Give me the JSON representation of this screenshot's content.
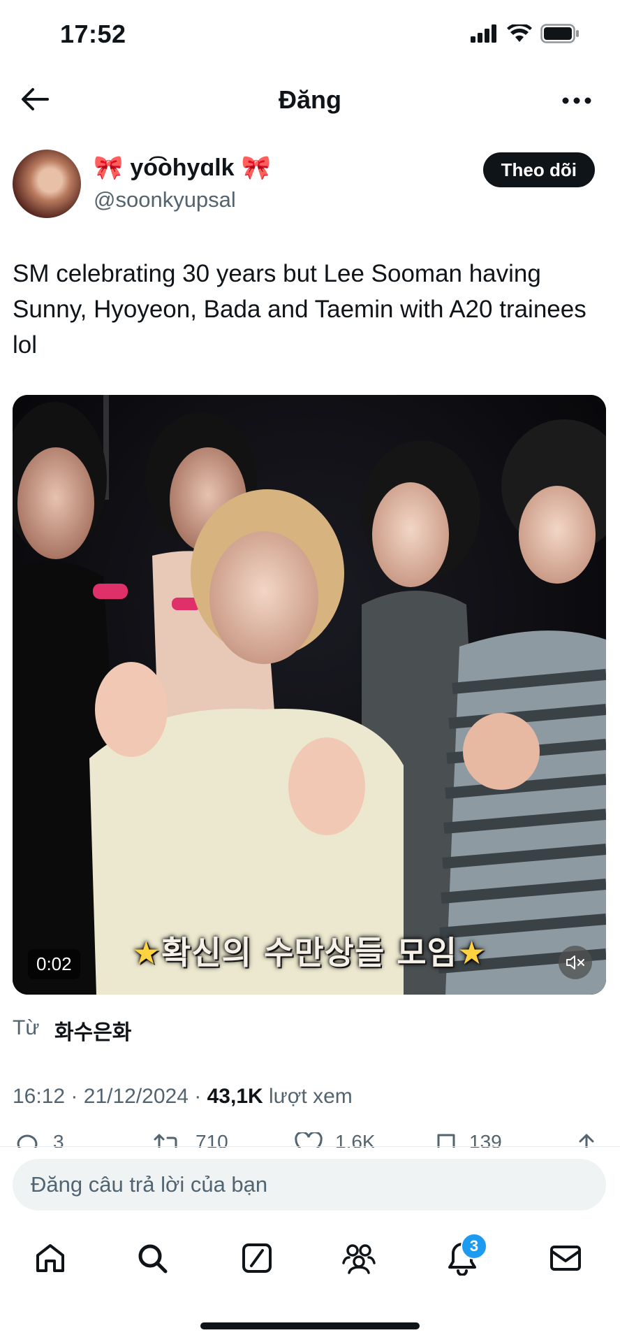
{
  "status_bar": {
    "time": "17:52"
  },
  "header": {
    "title": "Đăng"
  },
  "author": {
    "name": "🎀 yᦔhyᦔlk 🎀",
    "name_display": "yo͡ohyɑlk",
    "handle": "@soonkyupsal",
    "follow_label": "Theo dõi"
  },
  "tweet": {
    "text": "SM celebrating 30 years but Lee Sooman having Sunny, Hyoyeon, Bada and Taemin with A20 trainees lol"
  },
  "media": {
    "duration": "0:02",
    "caption": "확신의 수만상들 모임",
    "caption_star": "★"
  },
  "source": {
    "prefix": "Từ",
    "name": "화수은화"
  },
  "meta": {
    "time": "16:12",
    "date": "21/12/2024",
    "views": "43,1K",
    "views_label": "lượt xem",
    "sep": "·"
  },
  "actions": {
    "replies": "3",
    "reposts": "710",
    "likes": "1,6K",
    "bookmarks": "139"
  },
  "reply": {
    "placeholder": "Đăng câu trả lời của bạn"
  },
  "nav": {
    "notifications_badge": "3"
  },
  "colors": {
    "accent": "#1d9bf0",
    "text": "#0f1419",
    "muted": "#536471"
  }
}
